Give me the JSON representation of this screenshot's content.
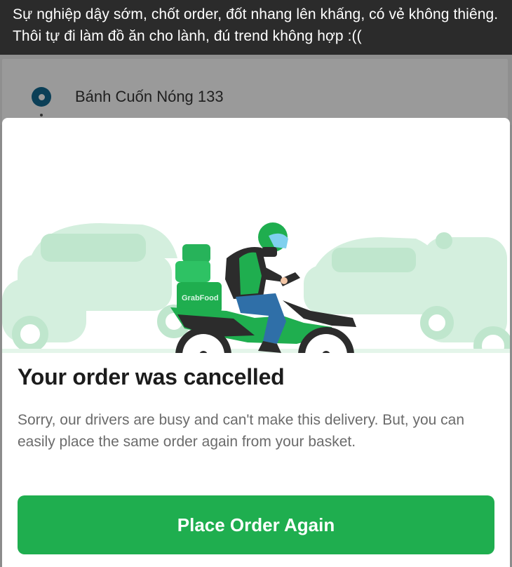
{
  "post": {
    "caption": "Sự nghiệp dậy sớm, chốt order, đốt nhang lên khấng, có vẻ không thiêng. Thôi tự đi làm đồ ăn cho lành, đú trend không hợp  :(("
  },
  "order": {
    "restaurant_name": "Bánh Cuốn Nóng 133"
  },
  "illustration": {
    "box_label": "GrabFood"
  },
  "dialog": {
    "title": "Your order was cancelled",
    "message": "Sorry, our drivers are busy and can't make this delivery. But, you can easily place the same order again from your basket.",
    "button_label": "Place Order Again"
  },
  "colors": {
    "brand_green": "#1fae4f",
    "light_green": "#c9ecd6",
    "pin_blue": "#0b3f57"
  }
}
